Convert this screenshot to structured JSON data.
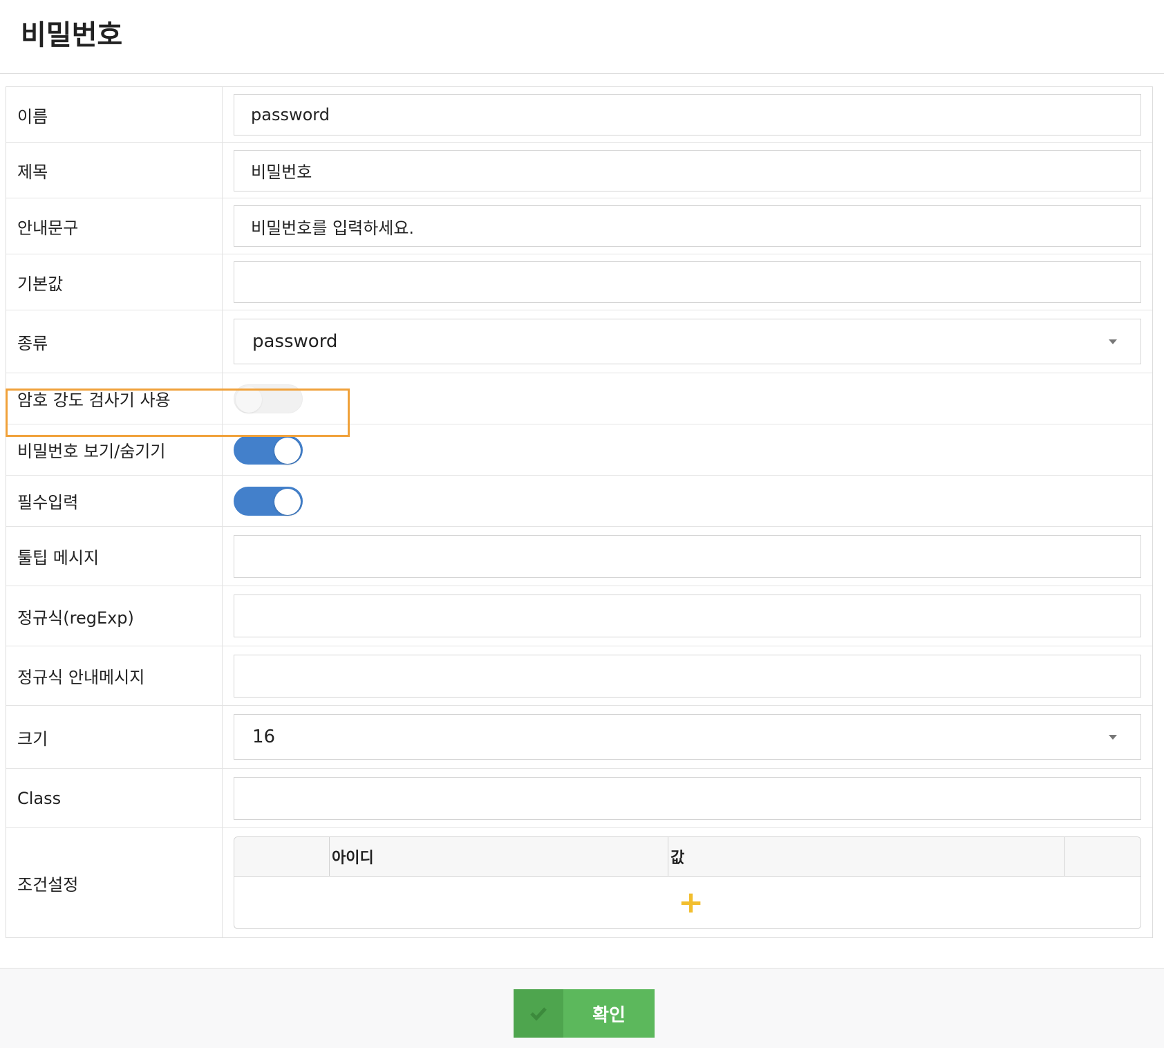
{
  "page": {
    "title": "비밀번호"
  },
  "fields": {
    "name": {
      "label": "이름",
      "value": "password"
    },
    "title": {
      "label": "제목",
      "value": "비밀번호"
    },
    "guide": {
      "label": "안내문구",
      "value": "비밀번호를 입력하세요."
    },
    "default_value": {
      "label": "기본값",
      "value": ""
    },
    "type": {
      "label": "종류",
      "value": "password"
    },
    "strength_checker": {
      "label": "암호 강도 검사기 사용",
      "enabled": false
    },
    "show_hide": {
      "label": "비밀번호 보기/숨기기",
      "enabled": true
    },
    "required": {
      "label": "필수입력",
      "enabled": true
    },
    "tooltip": {
      "label": "툴팁 메시지",
      "value": ""
    },
    "regexp": {
      "label": "정규식(regExp)",
      "value": ""
    },
    "regexp_message": {
      "label": "정규식 안내메시지",
      "value": ""
    },
    "size": {
      "label": "크기",
      "value": "16"
    },
    "class_name": {
      "label": "Class",
      "value": ""
    },
    "conditions": {
      "label": "조건설정",
      "columns": [
        "아이디",
        "값"
      ],
      "add_icon": "plus-icon"
    }
  },
  "footer": {
    "confirm_label": "확인",
    "confirm_icon": "check-icon"
  },
  "colors": {
    "toggle_on": "#4380cb",
    "highlight": "#f0a13a",
    "confirm": "#5cb85c",
    "plus": "#f2be2e"
  }
}
